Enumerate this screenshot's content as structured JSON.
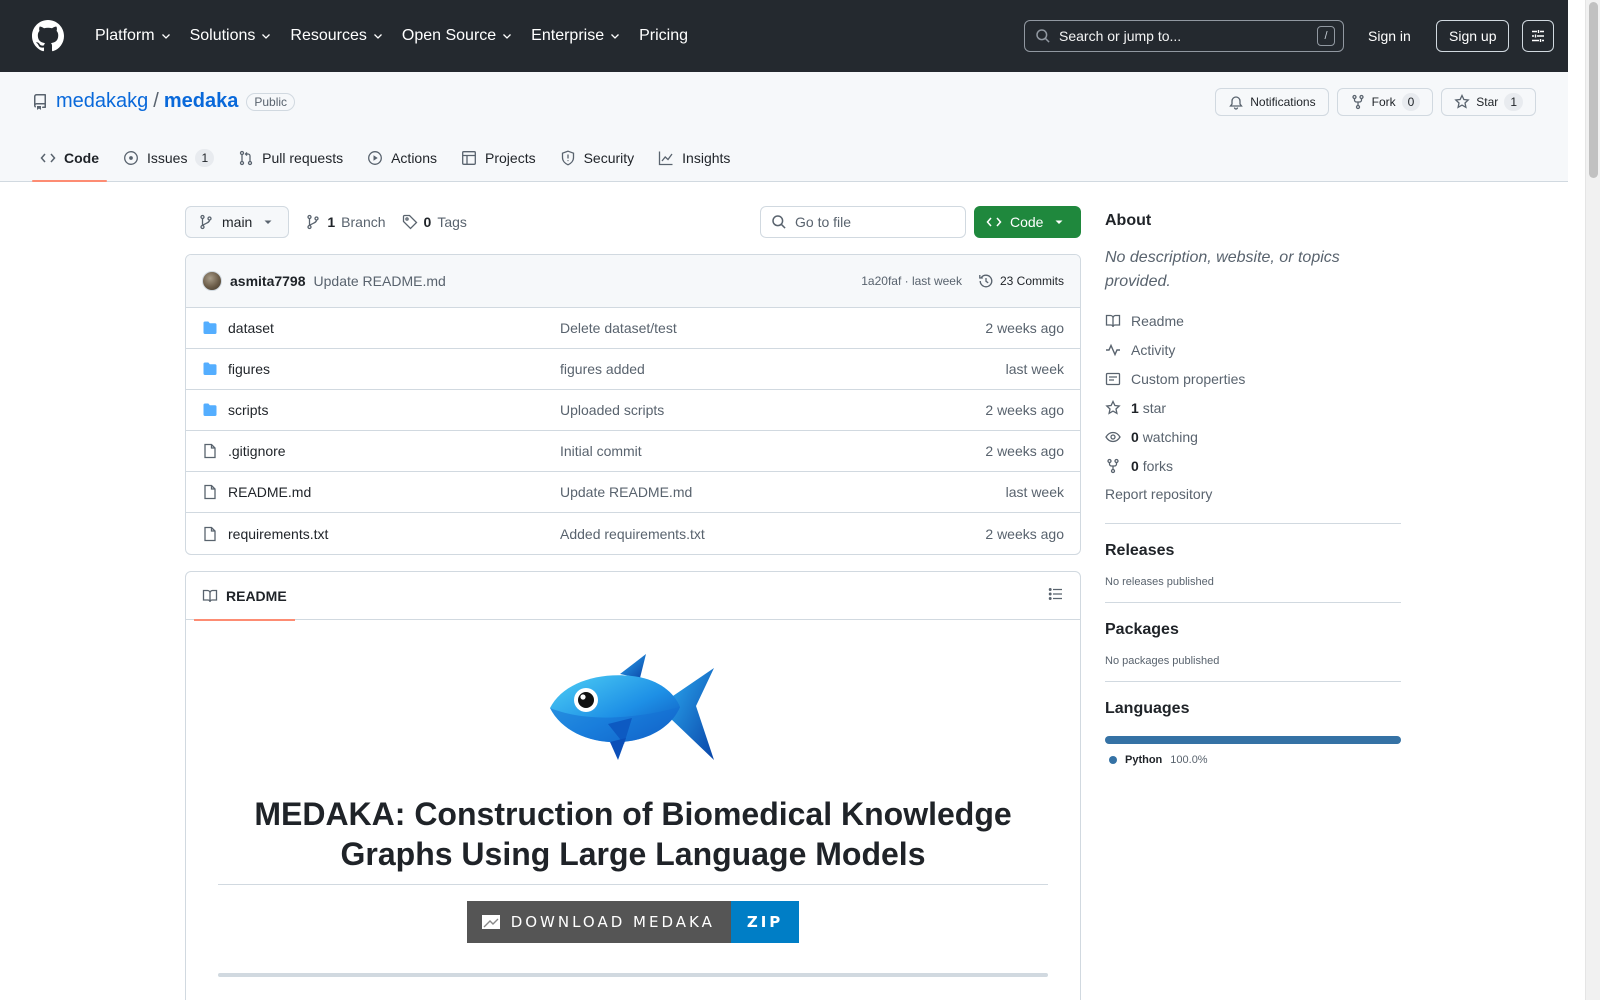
{
  "header": {
    "nav": [
      "Platform",
      "Solutions",
      "Resources",
      "Open Source",
      "Enterprise",
      "Pricing"
    ],
    "search_placeholder": "Search or jump to...",
    "search_key": "/",
    "signin": "Sign in",
    "signup": "Sign up"
  },
  "repo": {
    "owner": "medakakg",
    "separator": "/",
    "name": "medaka",
    "visibility": "Public",
    "notifications_label": "Notifications",
    "fork_label": "Fork",
    "fork_count": "0",
    "star_label": "Star",
    "star_count": "1"
  },
  "tabs": [
    {
      "label": "Code",
      "icon": "code-icon"
    },
    {
      "label": "Issues",
      "icon": "issue-opened-icon",
      "count": "1"
    },
    {
      "label": "Pull requests",
      "icon": "git-pull-request-icon"
    },
    {
      "label": "Actions",
      "icon": "play-icon"
    },
    {
      "label": "Projects",
      "icon": "table-icon"
    },
    {
      "label": "Security",
      "icon": "shield-icon"
    },
    {
      "label": "Insights",
      "icon": "graph-icon"
    }
  ],
  "toolbar": {
    "branch": "main",
    "branch_count": "1",
    "branch_label": "Branch",
    "tag_count": "0",
    "tag_label": "Tags",
    "goto_placeholder": "Go to file",
    "code_label": "Code"
  },
  "commit": {
    "author": "asmita7798",
    "message": "Update README.md",
    "sha_age": "1a20faf · last week",
    "commits_label": "23 Commits"
  },
  "files": [
    {
      "type": "folder",
      "name": "dataset",
      "message": "Delete dataset/test",
      "age": "2 weeks ago"
    },
    {
      "type": "folder",
      "name": "figures",
      "message": "figures added",
      "age": "last week"
    },
    {
      "type": "folder",
      "name": "scripts",
      "message": "Uploaded scripts",
      "age": "2 weeks ago"
    },
    {
      "type": "file",
      "name": ".gitignore",
      "message": "Initial commit",
      "age": "2 weeks ago"
    },
    {
      "type": "file",
      "name": "README.md",
      "message": "Update README.md",
      "age": "last week"
    },
    {
      "type": "file",
      "name": "requirements.txt",
      "message": "Added requirements.txt",
      "age": "2 weeks ago"
    }
  ],
  "readme": {
    "tab_label": "README",
    "title": "MEDAKA: Construction of Biomedical Knowledge Graphs Using Large Language Models",
    "download_label": "DOWNLOAD MEDAKA",
    "download_badge": "ZIP"
  },
  "sidebar": {
    "about_title": "About",
    "description": "No description, website, or topics provided.",
    "links": [
      {
        "icon": "book-icon",
        "value": "",
        "label": "Readme"
      },
      {
        "icon": "pulse-icon",
        "value": "",
        "label": "Activity"
      },
      {
        "icon": "note-icon",
        "value": "",
        "label": "Custom properties"
      },
      {
        "icon": "star-icon",
        "value": "1",
        "label": "star"
      },
      {
        "icon": "eye-icon",
        "value": "0",
        "label": "watching"
      },
      {
        "icon": "repo-forked-icon",
        "value": "0",
        "label": "forks"
      }
    ],
    "report": "Report repository",
    "releases_title": "Releases",
    "releases_text": "No releases published",
    "packages_title": "Packages",
    "packages_text": "No packages published",
    "languages_title": "Languages",
    "languages": [
      {
        "name": "Python",
        "percent": "100.0%",
        "color": "#3572a5"
      }
    ]
  },
  "colors": {
    "header_bg": "#24292f",
    "link": "#0969da",
    "primary_button": "#1f883d",
    "active_tab_underline": "#fd8c73"
  }
}
